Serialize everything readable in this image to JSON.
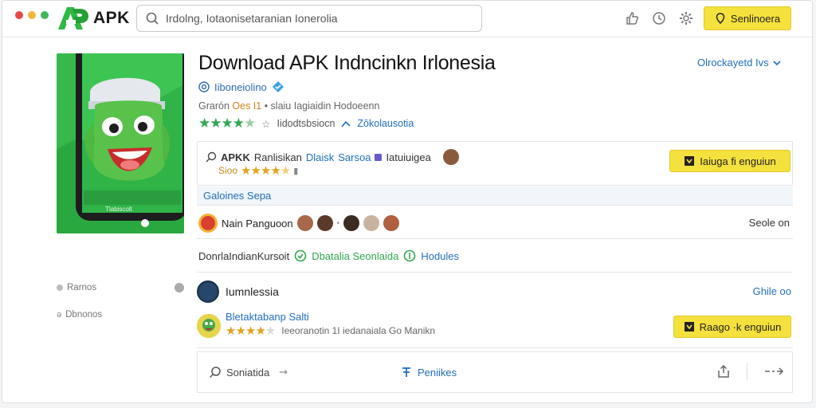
{
  "window": {
    "dots": [
      "#e54848",
      "#f0b73a",
      "#40b85a"
    ],
    "logo_text": "APK",
    "search_text": "Irdolng, Iotaonisetaranian Ionerolia",
    "top_button": "Senlinoera"
  },
  "app": {
    "title": "Download APK Indncinkn Irlonesia",
    "lang_select": "Olrockayetd Ivs",
    "developer": "Iiboneiolino",
    "meta_prefix": "Grarón",
    "meta_accent": "Oes I1",
    "meta_rest": "• slaiu Iagiaidin Hodoeenn",
    "rating_count": "Iidodtsbsiocn",
    "rating_link": "Zōkolausotia",
    "image_caption": "Tlabiscolt"
  },
  "apk_card": {
    "title_bold": "APKK",
    "title_a": "Ranlisikan",
    "title_b": "Dlaisk",
    "title_c": "Sarsoa",
    "title_d": "Iatuiuigea",
    "sub_label": "Sioo",
    "button": "Iaiuga fi enguiun"
  },
  "section": {
    "label": "Galoines Sepa"
  },
  "people": {
    "label": "Nain Panguoon",
    "right": "Seole on"
  },
  "download": {
    "prefix": "DonrlaIndianKursoit",
    "green": "Dbatalia Seonlaida",
    "blue": "Hodules"
  },
  "sidebar": {
    "items": [
      "Rarnos",
      "Dbnonos"
    ]
  },
  "list": {
    "row1_title": "Iumnlessia",
    "row1_right": "Ghile oo",
    "row2_title": "Bletaktabanp Salti",
    "row2_sub": "Ieeoranotin 1I iedanaiala Go Manikn",
    "row2_button": "Raago ·k enguiun"
  },
  "actions": {
    "left": "Soniatida",
    "mid": "Peniikes"
  }
}
